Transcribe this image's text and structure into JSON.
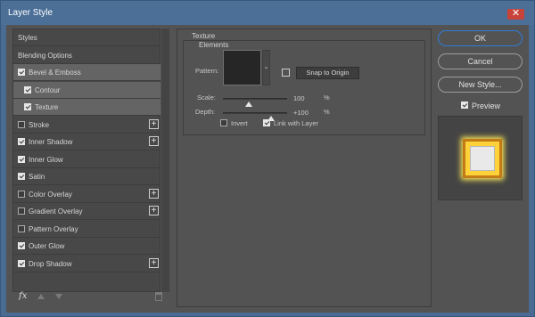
{
  "window": {
    "title": "Layer Style",
    "close_glyph": "✕"
  },
  "sidebar": {
    "items": [
      {
        "label": "Styles",
        "checkbox": null,
        "plus": false,
        "selected": false
      },
      {
        "label": "Blending Options",
        "checkbox": null,
        "plus": false,
        "selected": false
      },
      {
        "label": "Bevel & Emboss",
        "checkbox": true,
        "plus": false,
        "selected": true
      },
      {
        "label": "Contour",
        "checkbox": true,
        "plus": false,
        "selected": true,
        "indent": true
      },
      {
        "label": "Texture",
        "checkbox": true,
        "plus": false,
        "selected": true,
        "indent": true
      },
      {
        "label": "Stroke",
        "checkbox": false,
        "plus": true,
        "selected": false
      },
      {
        "label": "Inner Shadow",
        "checkbox": true,
        "plus": true,
        "selected": false
      },
      {
        "label": "Inner Glow",
        "checkbox": true,
        "plus": false,
        "selected": false
      },
      {
        "label": "Satin",
        "checkbox": true,
        "plus": false,
        "selected": false
      },
      {
        "label": "Color Overlay",
        "checkbox": false,
        "plus": true,
        "selected": false
      },
      {
        "label": "Gradient Overlay",
        "checkbox": false,
        "plus": true,
        "selected": false
      },
      {
        "label": "Pattern Overlay",
        "checkbox": false,
        "plus": false,
        "selected": false
      },
      {
        "label": "Outer Glow",
        "checkbox": true,
        "plus": false,
        "selected": false
      },
      {
        "label": "Drop Shadow",
        "checkbox": true,
        "plus": true,
        "selected": false
      }
    ],
    "fx_label": "fx",
    "icons": [
      "fx-icon",
      "move-up-icon",
      "move-down-icon",
      "trash-icon"
    ]
  },
  "texture": {
    "group_title": "Texture",
    "elements_title": "Elements",
    "pattern_label": "Pattern:",
    "snap_button": "Snap to Origin",
    "scale_label": "Scale:",
    "scale_value": "100",
    "scale_unit": "%",
    "scale_fraction": 0.4,
    "depth_label": "Depth:",
    "depth_value": "+100",
    "depth_unit": "%",
    "depth_fraction": 0.75,
    "invert_label": "Invert",
    "invert_checked": false,
    "link_label": "Link with Layer",
    "link_checked": true
  },
  "buttons": {
    "ok": "OK",
    "cancel": "Cancel",
    "new_style": "New Style...",
    "preview_label": "Preview",
    "preview_checked": true
  },
  "colors": {
    "accent": "#2f7bd6",
    "title_bar": "#4b6f97",
    "dialog_bg": "#535353",
    "preview_gold": "#ffd23a"
  }
}
